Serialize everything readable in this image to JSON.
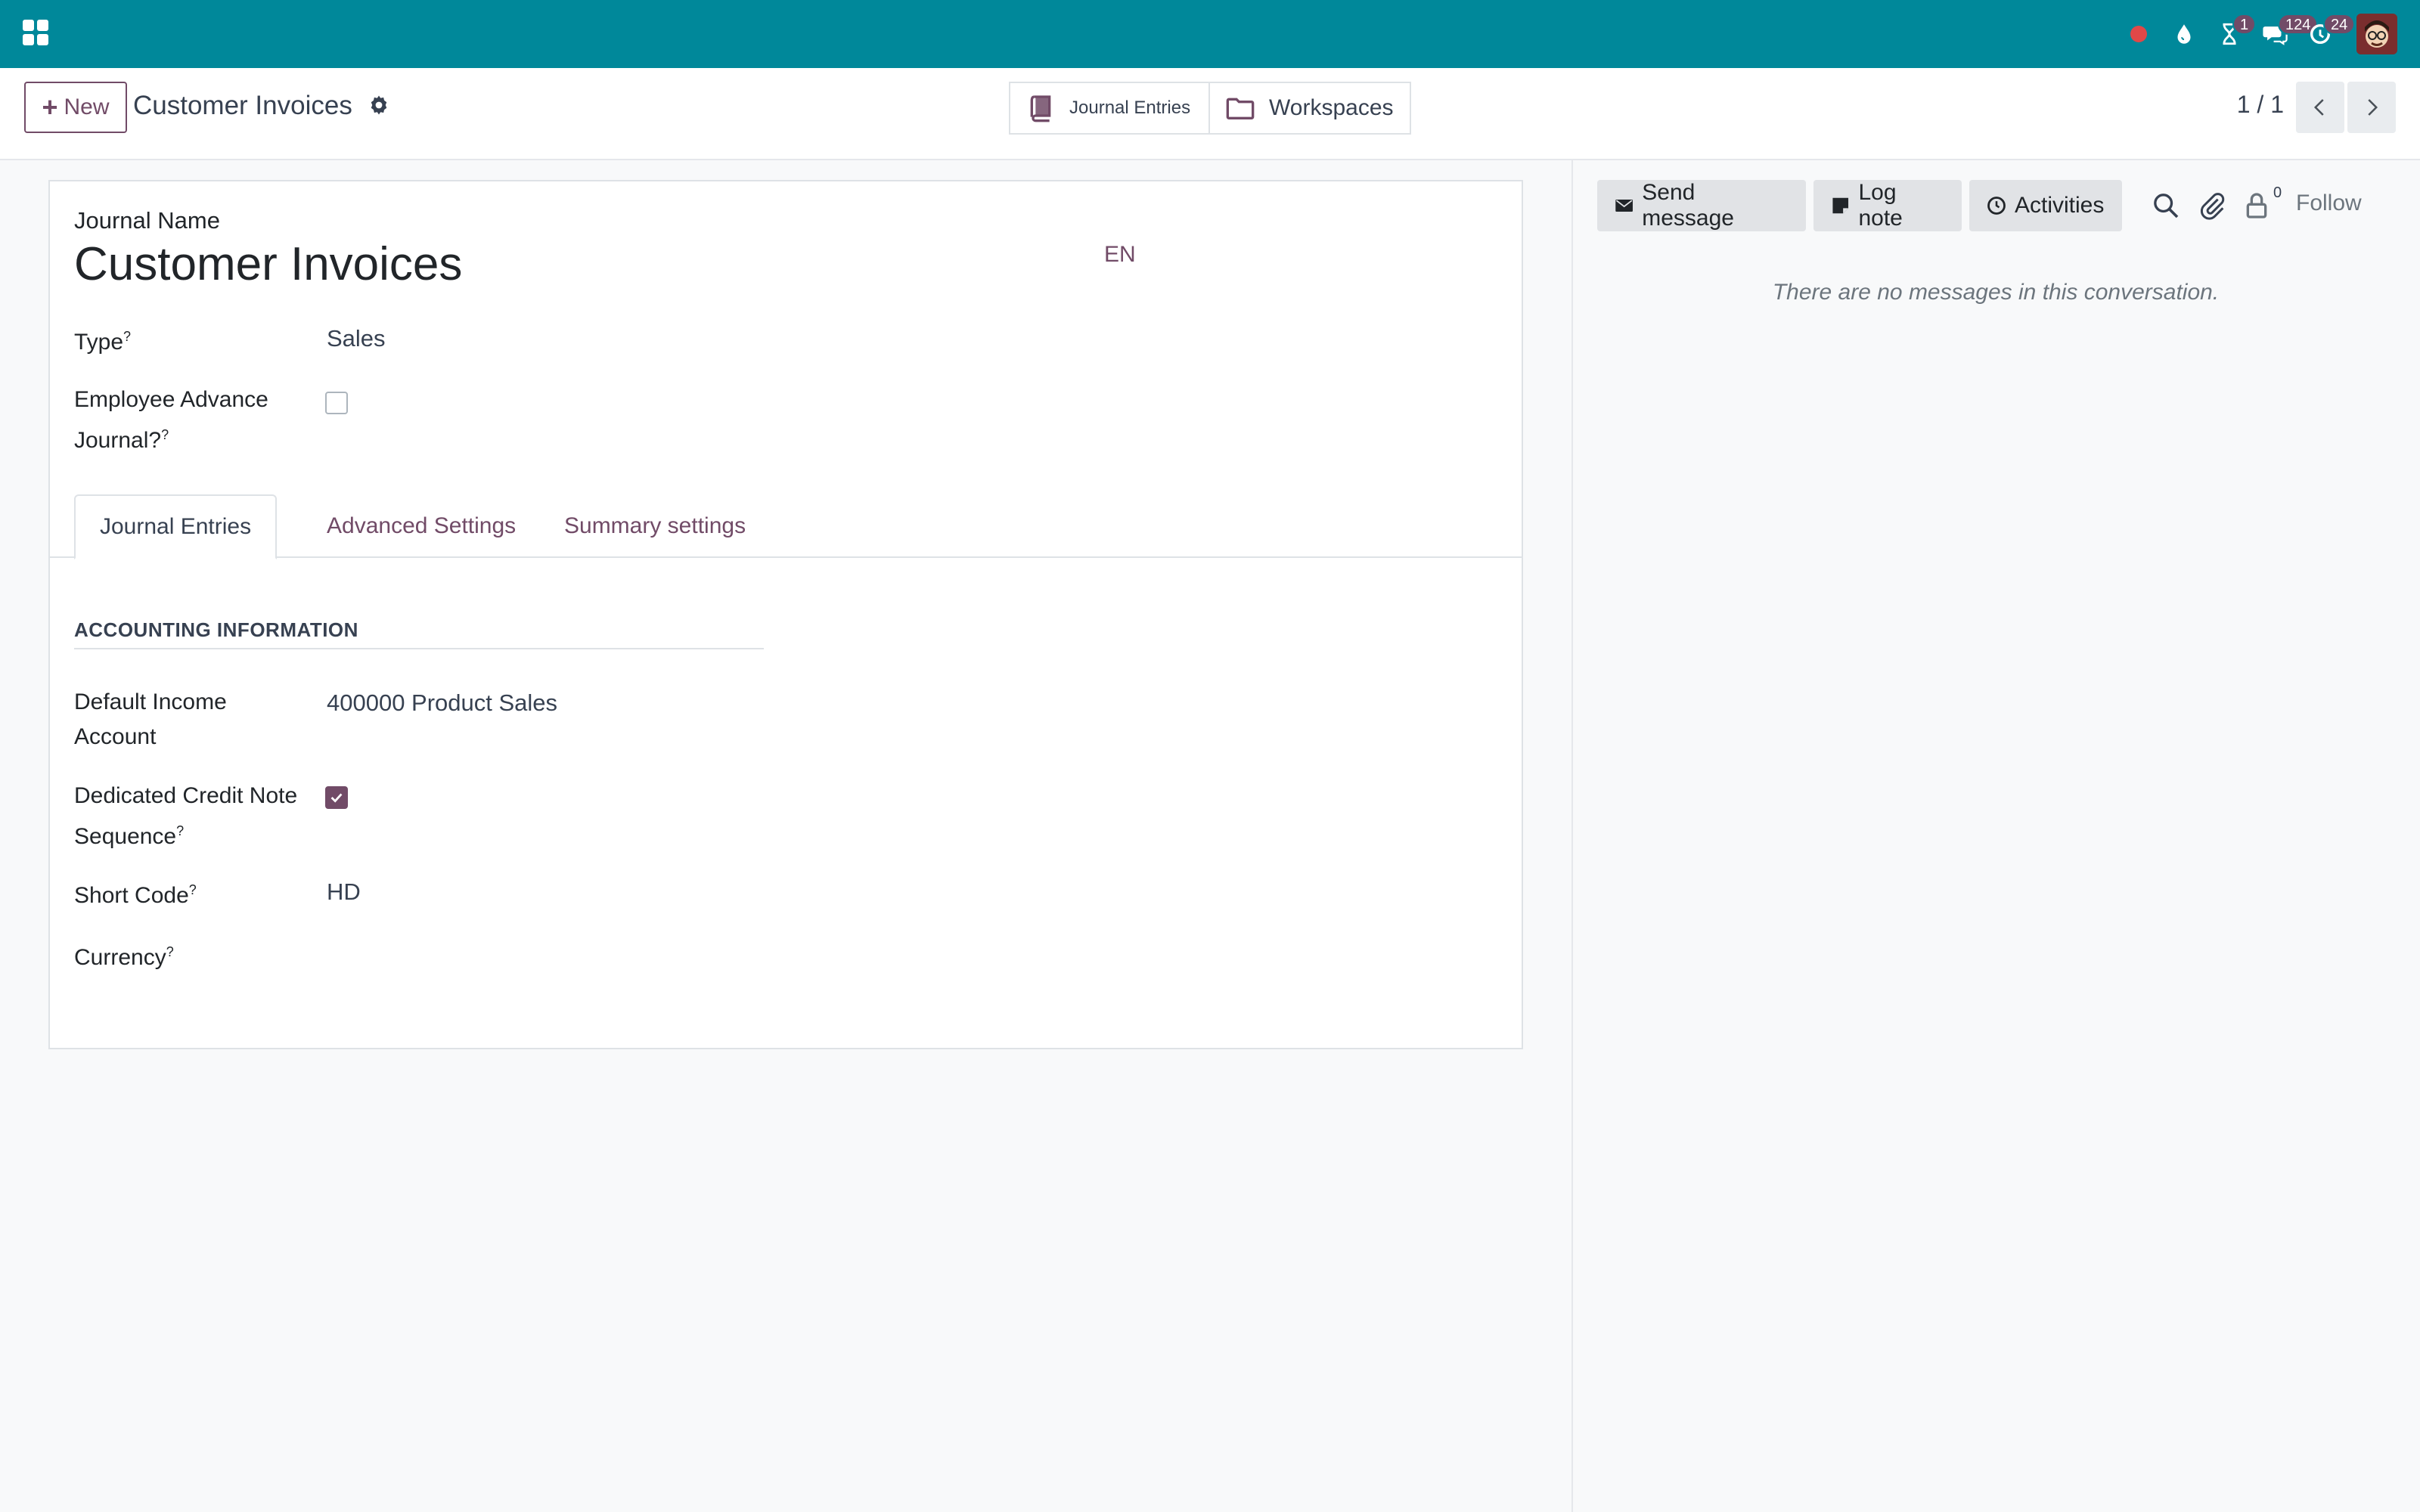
{
  "navbar": {
    "badges": {
      "activities": "1",
      "messages": "124",
      "updates": "24"
    }
  },
  "control_panel": {
    "new_label": "New",
    "title": "Customer Invoices",
    "smart_buttons": {
      "journal_entries": "Journal Entries",
      "workspaces": "Workspaces"
    },
    "pager": "1 / 1"
  },
  "form": {
    "journal_name_label": "Journal Name",
    "journal_name": "Customer Invoices",
    "lang": "EN",
    "type_label": "Type",
    "type_value": "Sales",
    "employee_advance_label_1": "Employee Advance",
    "employee_advance_label_2": "Journal?",
    "employee_advance_checked": false,
    "tooltip_mark": "?",
    "tabs": [
      "Journal Entries",
      "Advanced Settings",
      "Summary settings"
    ],
    "active_tab": 0,
    "section_title": "ACCOUNTING INFORMATION",
    "default_income_label_1": "Default Income",
    "default_income_label_2": "Account",
    "default_income_value": "400000 Product Sales",
    "credit_note_label_1": "Dedicated Credit Note",
    "credit_note_label_2": "Sequence",
    "credit_note_checked": true,
    "short_code_label": "Short Code",
    "short_code_value": "HD",
    "currency_label": "Currency",
    "currency_value": ""
  },
  "chatter": {
    "send_message": "Send message",
    "log_note": "Log note",
    "activities": "Activities",
    "follower_count": "0",
    "follow": "Follow",
    "empty": "There are no messages in this conversation."
  },
  "colors": {
    "navbar": "#00889a",
    "brand": "#714b67",
    "record_dot": "#e04848"
  }
}
